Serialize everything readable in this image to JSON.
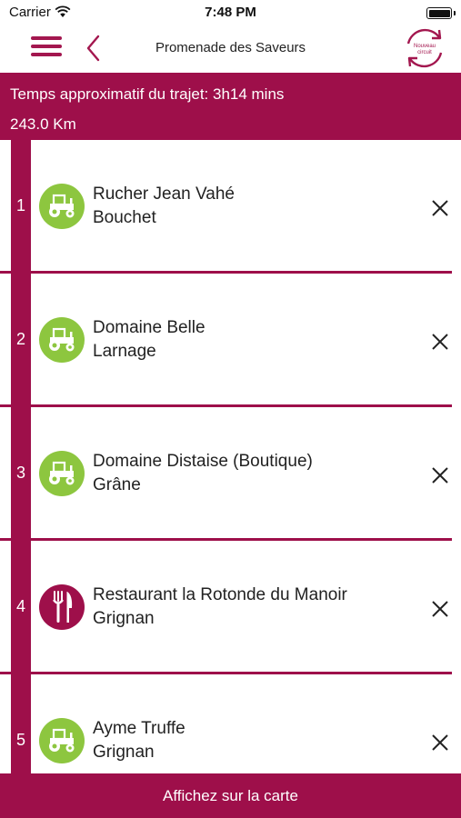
{
  "status_bar": {
    "carrier": "Carrier",
    "time": "7:48 PM",
    "icons": [
      "wifi-icon",
      "battery-icon"
    ]
  },
  "nav": {
    "title": "Promenade des Saveurs",
    "icons": [
      "menu-icon",
      "chevron-left-icon",
      "new-circuit-refresh-icon"
    ],
    "new_circuit_label": "Nouveau circuit"
  },
  "summary": {
    "time_text": "Temps approximatif du trajet: 3h14 mins",
    "distance_text": "243.0 Km"
  },
  "stops": [
    {
      "number": "1",
      "name": "Rucher Jean Vahé",
      "city": "Bouchet",
      "icon": "tractor-icon",
      "badge_color": "#8dc63f"
    },
    {
      "number": "2",
      "name": "Domaine Belle",
      "city": "Larnage",
      "icon": "tractor-icon",
      "badge_color": "#8dc63f"
    },
    {
      "number": "3",
      "name": "Domaine Distaise (Boutique)",
      "city": "Grâne",
      "icon": "tractor-icon",
      "badge_color": "#8dc63f"
    },
    {
      "number": "4",
      "name": "Restaurant la Rotonde du Manoir",
      "city": "Grignan",
      "icon": "fork-knife-icon",
      "badge_color": "#9e0f4a"
    },
    {
      "number": "5",
      "name": "Ayme Truffe",
      "city": "Grignan",
      "icon": "tractor-icon",
      "badge_color": "#8dc63f"
    }
  ],
  "footer": {
    "label": "Affichez sur la carte"
  },
  "colors": {
    "brand": "#9e0f4a",
    "accent_green": "#8dc63f",
    "text": "#222222"
  }
}
